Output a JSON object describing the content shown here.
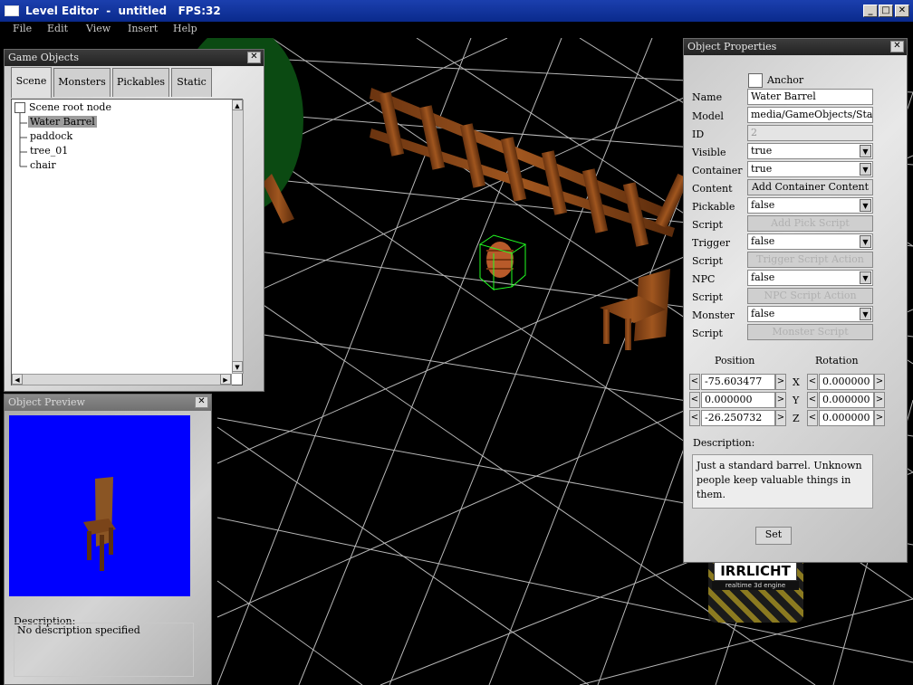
{
  "window": {
    "title": "Level Editor  -  untitled   FPS:32",
    "minimize": "_",
    "maximize": "□",
    "close": "✕"
  },
  "menu": [
    "File",
    "Edit",
    "View",
    "Insert",
    "Help"
  ],
  "game_objects": {
    "title": "Game Objects",
    "tabs": [
      "Scene",
      "Monsters",
      "Pickables",
      "Static"
    ],
    "active_tab": "Scene",
    "root": "Scene root node",
    "items": [
      "Water Barrel",
      "paddock",
      "tree_01",
      "chair"
    ],
    "selected": "Water Barrel"
  },
  "object_preview": {
    "title": "Object Preview",
    "description_label": "Description:",
    "description": "No description specified",
    "background": "#0000ff"
  },
  "object_properties": {
    "title": "Object Properties",
    "anchor_label": "Anchor",
    "name_label": "Name",
    "name_value": "Water Barrel",
    "model_label": "Model",
    "model_value": "media/GameObjects/Stati",
    "id_label": "ID",
    "id_value": "2",
    "visible_label": "Visible",
    "visible_value": "true",
    "container_label": "Container",
    "container_value": "true",
    "content_label": "Content",
    "add_container_content": "Add Container Content",
    "pickable_label": "Pickable",
    "pickable_value": "false",
    "script_label": "Script",
    "add_pick_script": "Add Pick Script",
    "trigger_label": "Trigger",
    "trigger_value": "false",
    "trigger_script_action": "Trigger Script Action",
    "npc_label": "NPC",
    "npc_value": "false",
    "npc_script_action": "NPC Script Action",
    "monster_label": "Monster",
    "monster_value": "false",
    "monster_script": "Monster Script",
    "position_label": "Position",
    "rotation_label": "Rotation",
    "x_label": "X",
    "y_label": "Y",
    "z_label": "Z",
    "position": [
      "-75.603477",
      "0.000000",
      "-26.250732"
    ],
    "rotation": [
      "0.000000",
      "0.000000",
      "0.000000"
    ],
    "description_label": "Description:",
    "description": "Just a standard barrel. Unknown people keep valuable things in them.",
    "set_button": "Set"
  },
  "logo": {
    "brand": "IRRLICHT",
    "tagline": "realtime 3d engine"
  },
  "colors": {
    "titlebar": "#0a2a8c",
    "selection_box": "#22ff22",
    "grid": "#d8d8d8"
  }
}
